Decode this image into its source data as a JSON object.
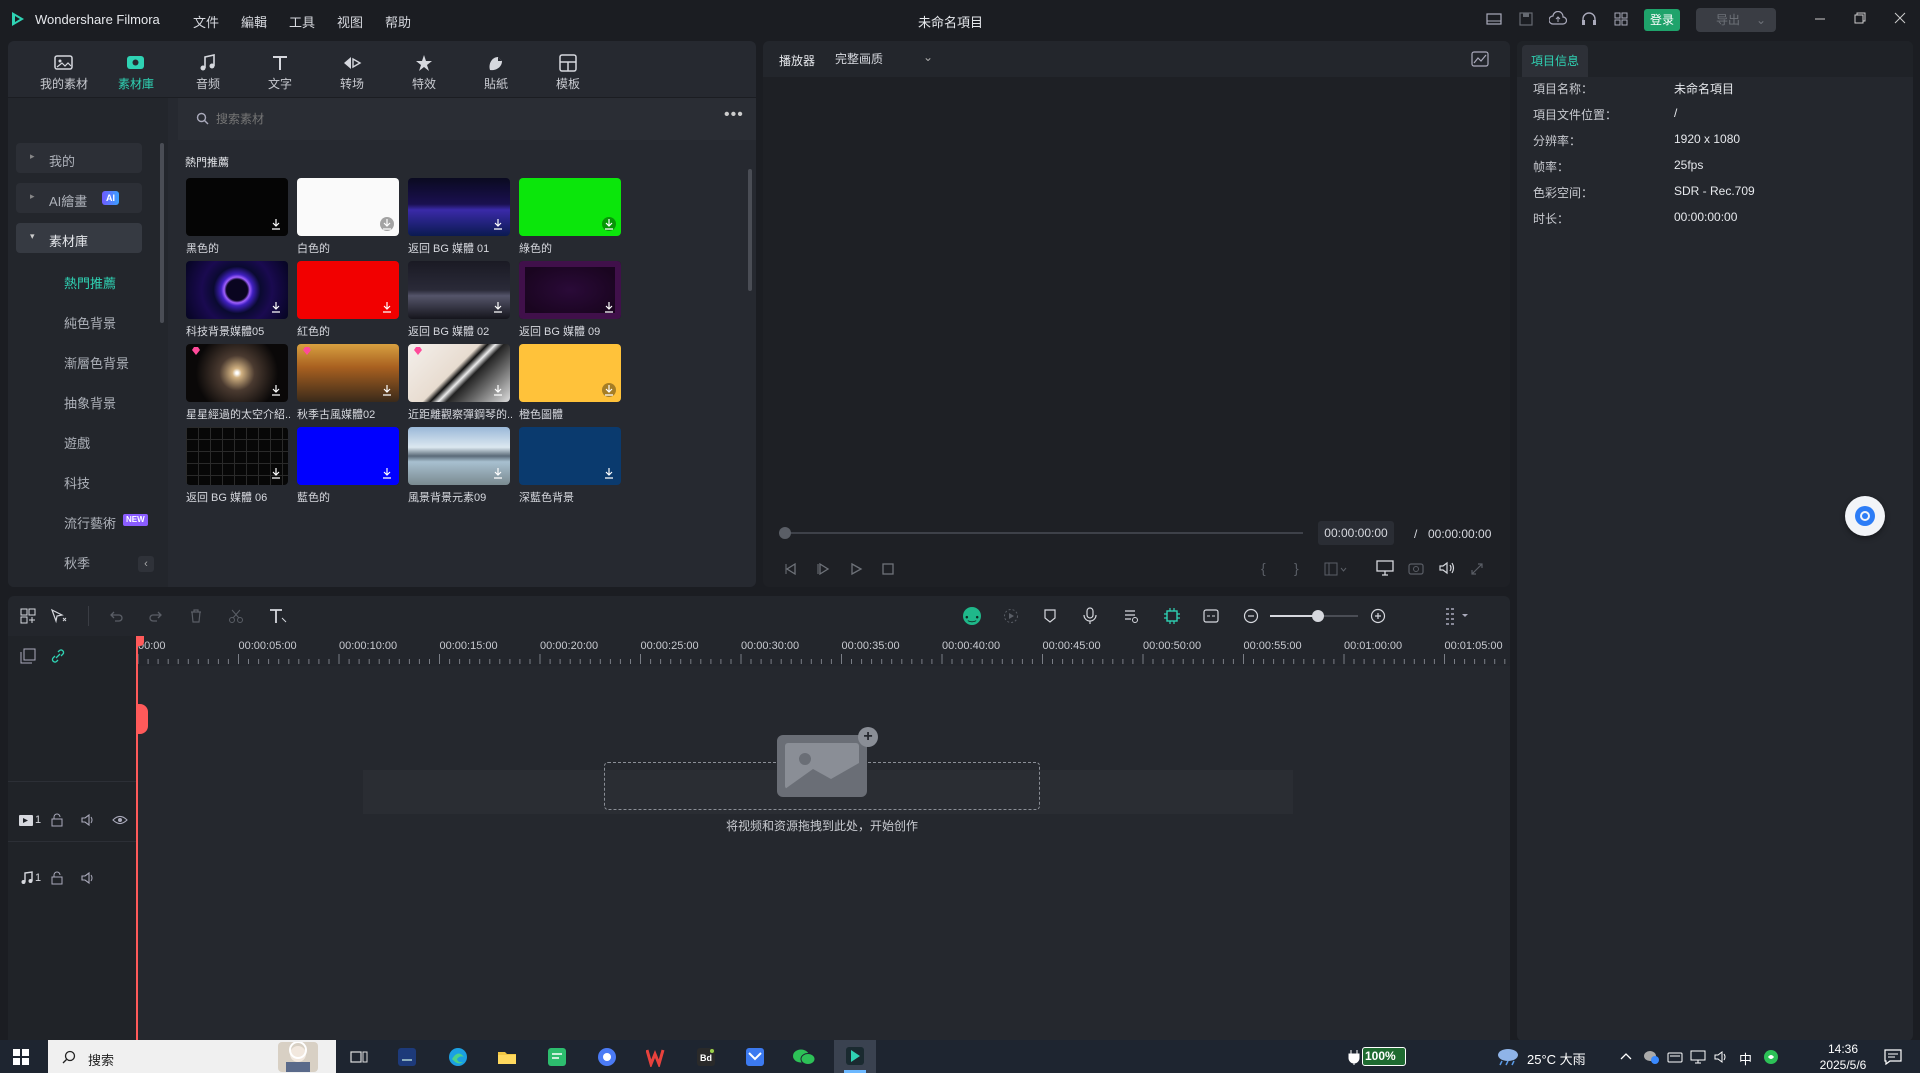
{
  "app": {
    "title": "Wondershare Filmora",
    "project_title": "未命名項目",
    "login_label": "登录",
    "export_label": "导出"
  },
  "menu": {
    "items": [
      "文件",
      "編輯",
      "工具",
      "视图",
      "帮助"
    ]
  },
  "toolbar_tabs": [
    {
      "label": "我的素材",
      "icon": "my-media-icon"
    },
    {
      "label": "素材庫",
      "icon": "stock-library-icon"
    },
    {
      "label": "音频",
      "icon": "music-note-icon"
    },
    {
      "label": "文字",
      "icon": "text-icon"
    },
    {
      "label": "转场",
      "icon": "transition-icon"
    },
    {
      "label": "特效",
      "icon": "effects-star-icon"
    },
    {
      "label": "貼紙",
      "icon": "sticker-icon"
    },
    {
      "label": "模板",
      "icon": "template-icon"
    }
  ],
  "sidebar": {
    "sections": [
      {
        "label": "我的",
        "expanded": false
      },
      {
        "label": "AI繪畫",
        "badge": "AI",
        "expanded": false
      },
      {
        "label": "素材庫",
        "expanded": true
      }
    ],
    "items": [
      {
        "label": "熱門推薦",
        "active": true
      },
      {
        "label": "純色背景"
      },
      {
        "label": "漸層色背景"
      },
      {
        "label": "抽象背景"
      },
      {
        "label": "遊戲"
      },
      {
        "label": "科技"
      },
      {
        "label": "流行藝術",
        "badge": "NEW"
      },
      {
        "label": "秋季"
      }
    ]
  },
  "search": {
    "placeholder": "搜索素材"
  },
  "section_title": "熱門推薦",
  "media_items": [
    {
      "label": "黑色的",
      "thumb": "black"
    },
    {
      "label": "白色的",
      "thumb": "white"
    },
    {
      "label": "返回 BG 媒體 01",
      "thumb": "grid-blue"
    },
    {
      "label": "綠色的",
      "thumb": "green"
    },
    {
      "label": "科技背景媒體05",
      "thumb": "ring"
    },
    {
      "label": "紅色的",
      "thumb": "red"
    },
    {
      "label": "返回 BG 媒體 02",
      "thumb": "grid-dark"
    },
    {
      "label": "返回 BG 媒體 09",
      "thumb": "frame-purple"
    },
    {
      "label": "星星經過的太空介紹...",
      "thumb": "stars",
      "premium": true
    },
    {
      "label": "秋季古風媒體02",
      "thumb": "autumn",
      "premium": true
    },
    {
      "label": "近距離觀察彈鋼琴的...",
      "thumb": "piano",
      "premium": true
    },
    {
      "label": "橙色圖體",
      "thumb": "orange"
    },
    {
      "label": "返回 BG 媒體 06",
      "thumb": "grid-black"
    },
    {
      "label": "藍色的",
      "thumb": "blue"
    },
    {
      "label": "風景背景元素09",
      "thumb": "lake"
    },
    {
      "label": "深藍色背景",
      "thumb": "navy"
    }
  ],
  "player": {
    "label": "播放器",
    "quality": "完整画质",
    "current_time": "00:00:00:00",
    "separator": "/",
    "total_time": "00:00:00:00"
  },
  "project_info": {
    "tab_label": "項目信息",
    "rows": [
      {
        "label": "項目名称：",
        "value": "未命名項目"
      },
      {
        "label": "項目文件位置：",
        "value": "/"
      },
      {
        "label": "分辨率：",
        "value": "1920 x 1080"
      },
      {
        "label": "帧率：",
        "value": "25fps"
      },
      {
        "label": "色彩空间：",
        "value": "SDR - Rec.709"
      },
      {
        "label": "时长：",
        "value": "00:00:00:00"
      }
    ]
  },
  "timeline": {
    "ticks": [
      "00:00",
      "00:00:05:00",
      "00:00:10:00",
      "00:00:15:00",
      "00:00:20:00",
      "00:00:25:00",
      "00:00:30:00",
      "00:00:35:00",
      "00:00:40:00",
      "00:00:45:00",
      "00:00:50:00",
      "00:00:55:00",
      "00:01:00:00",
      "00:01:05:00"
    ],
    "drop_hint": "将视频和资源拖拽到此处，开始创作",
    "video_track_no": "1",
    "audio_track_no": "1",
    "zoom_level": 0.55
  },
  "taskbar": {
    "search_label": "搜索",
    "battery": "100%",
    "weather": "25°C 大雨",
    "ime": "中",
    "time": "14:36",
    "date": "2025/5/6"
  },
  "colors": {
    "accent": "#2fd3b4",
    "playhead": "#ff5a5a",
    "login_green": "#1fa36b"
  }
}
